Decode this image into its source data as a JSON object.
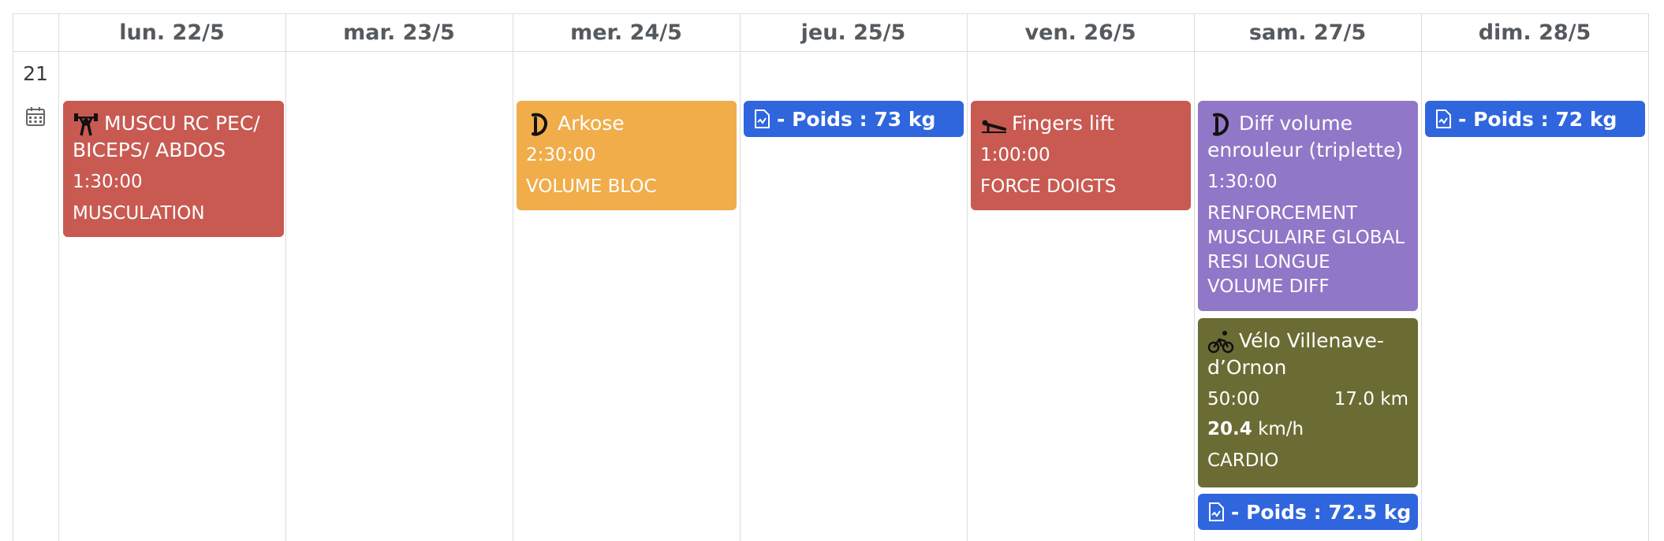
{
  "week": "21",
  "days": [
    "lun. 22/5",
    "mar. 23/5",
    "mer. 24/5",
    "jeu. 25/5",
    "ven. 26/5",
    "sam. 27/5",
    "dim. 28/5"
  ],
  "events": {
    "mon": {
      "title": "MUSCU RC PEC/ BICEPS/ ABDOS",
      "duration": "1:30:00",
      "note": "MUSCULATION",
      "color": "#c85a52",
      "icon": "weightlifting-icon"
    },
    "wed": {
      "title": "Arkose",
      "duration": "2:30:00",
      "note": "VOLUME BLOC",
      "color": "#f0ad4a",
      "icon": "climbing-app-icon"
    },
    "thu_weight": {
      "label": "- Poids : 73 kg",
      "color": "#2f66de"
    },
    "fri": {
      "title": "Fingers lift",
      "duration": "1:00:00",
      "note": "FORCE DOIGTS",
      "color": "#c85a52",
      "icon": "pushup-icon"
    },
    "sat1": {
      "title": "Diff volume enrouleur (triplette)",
      "duration": "1:30:00",
      "note": [
        "RENFORCEMENT MUSCULAIRE GLOBAL",
        "RESI LONGUE",
        "VOLUME DIFF"
      ],
      "color": "#9177c7",
      "icon": "climbing-app-icon"
    },
    "sat2": {
      "title": "Vélo Villenave-d’Ornon",
      "duration": "50:00",
      "distance": "17.0 km",
      "speed_value": "20.4",
      "speed_unit": "km/h",
      "note": "CARDIO",
      "color": "#6b6c34",
      "icon": "bike-icon"
    },
    "sat_weight": {
      "label": "- Poids : 72.5 kg",
      "color": "#2f66de"
    },
    "sun_weight": {
      "label": "- Poids : 72 kg",
      "color": "#2f66de"
    }
  }
}
